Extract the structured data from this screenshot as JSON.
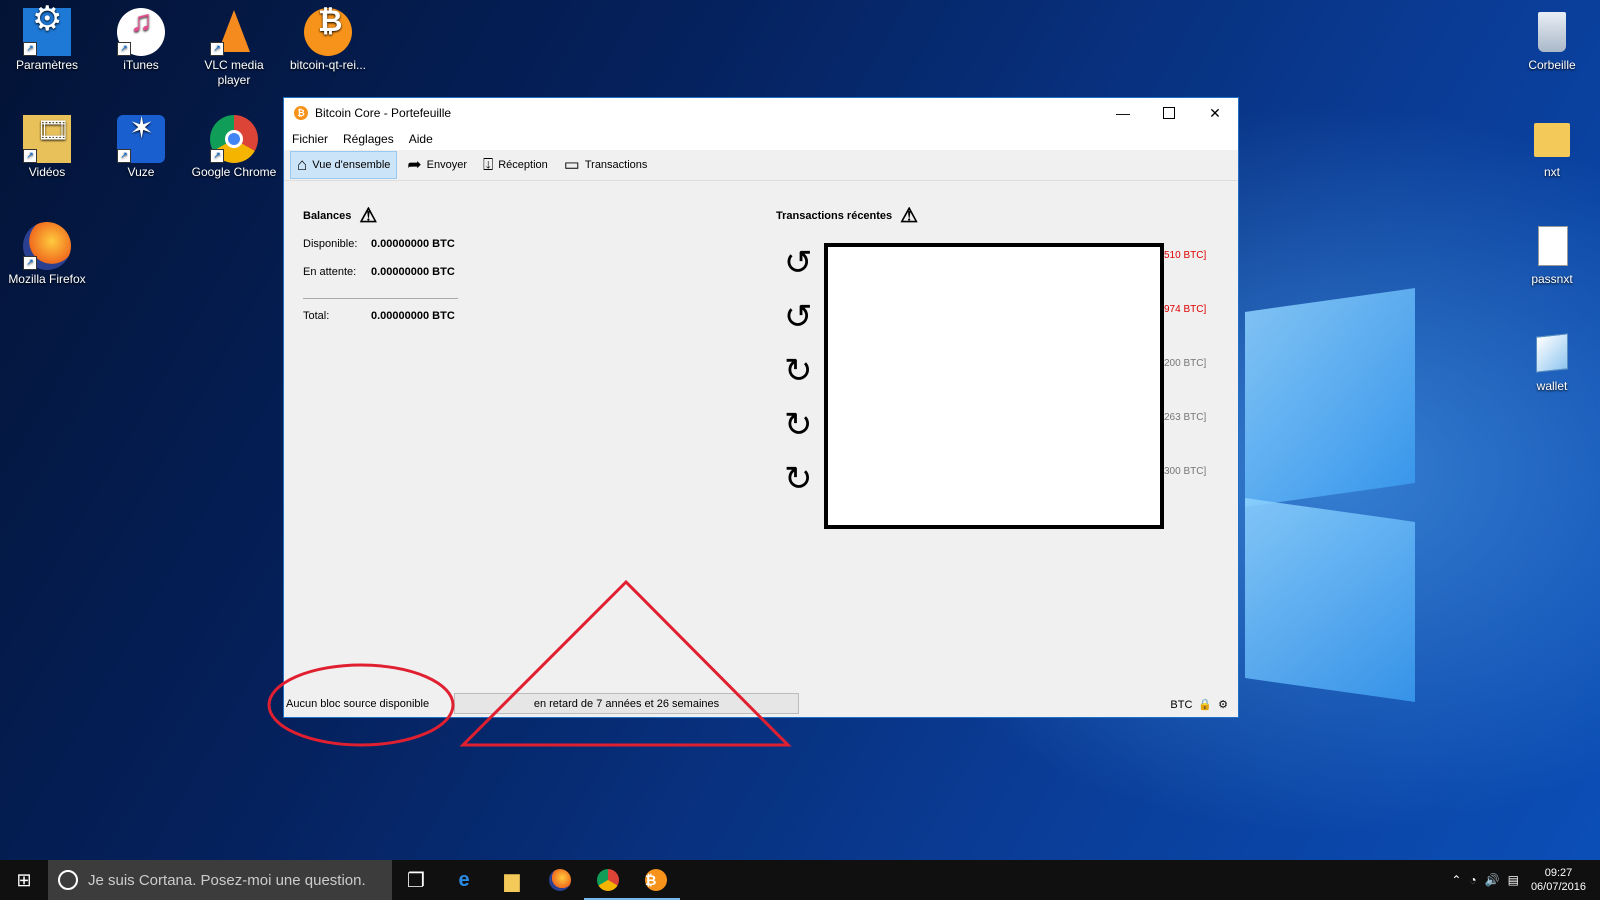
{
  "desktop": {
    "icons_left": [
      {
        "label": "Paramètres",
        "icon": "settings-gear-icon"
      },
      {
        "label": "iTunes",
        "icon": "itunes-icon"
      },
      {
        "label": "VLC media player",
        "icon": "vlc-cone-icon"
      },
      {
        "label": "bitcoin-qt-rei...",
        "icon": "bitcoin-icon"
      },
      {
        "label": "Vidéos",
        "icon": "videos-folder-icon"
      },
      {
        "label": "Vuze",
        "icon": "vuze-frog-icon"
      },
      {
        "label": "Google Chrome",
        "icon": "chrome-icon"
      },
      {
        "label": "Mozilla Firefox",
        "icon": "firefox-icon"
      }
    ],
    "icons_right": [
      {
        "label": "Corbeille",
        "icon": "recycle-bin-icon"
      },
      {
        "label": "nxt",
        "icon": "folder-icon"
      },
      {
        "label": "passnxt",
        "icon": "document-icon"
      },
      {
        "label": "wallet",
        "icon": "wallet-file-icon"
      }
    ]
  },
  "window": {
    "title": "Bitcoin Core - Portefeuille",
    "menu": [
      "Fichier",
      "Réglages",
      "Aide"
    ],
    "toolbar": [
      {
        "label": "Vue d'ensemble",
        "icon": "home-icon",
        "active": true
      },
      {
        "label": "Envoyer",
        "icon": "send-arrow-icon",
        "active": false
      },
      {
        "label": "Réception",
        "icon": "receive-icon",
        "active": false
      },
      {
        "label": "Transactions",
        "icon": "transactions-card-icon",
        "active": false
      }
    ],
    "balances": {
      "title": "Balances",
      "available_label": "Disponible:",
      "available_value": "0.00000000 BTC",
      "pending_label": "En attente:",
      "pending_value": "0.00000000 BTC",
      "total_label": "Total:",
      "total_value": "0.00000000 BTC"
    },
    "recent": {
      "title": "Transactions récentes",
      "amounts": [
        "510 BTC]",
        "974 BTC]",
        "200 BTC]",
        "263 BTC]",
        "300 BTC]"
      ],
      "negative_color": "#d00000"
    },
    "status": {
      "left": "Aucun bloc source disponible",
      "progress": "en retard de 7 années et 26 semaines",
      "unit": "BTC"
    }
  },
  "taskbar": {
    "search_placeholder": "Je suis Cortana. Posez-moi une question.",
    "time": "09:27",
    "date": "06/07/2016"
  },
  "annotation_color": "#e02030"
}
